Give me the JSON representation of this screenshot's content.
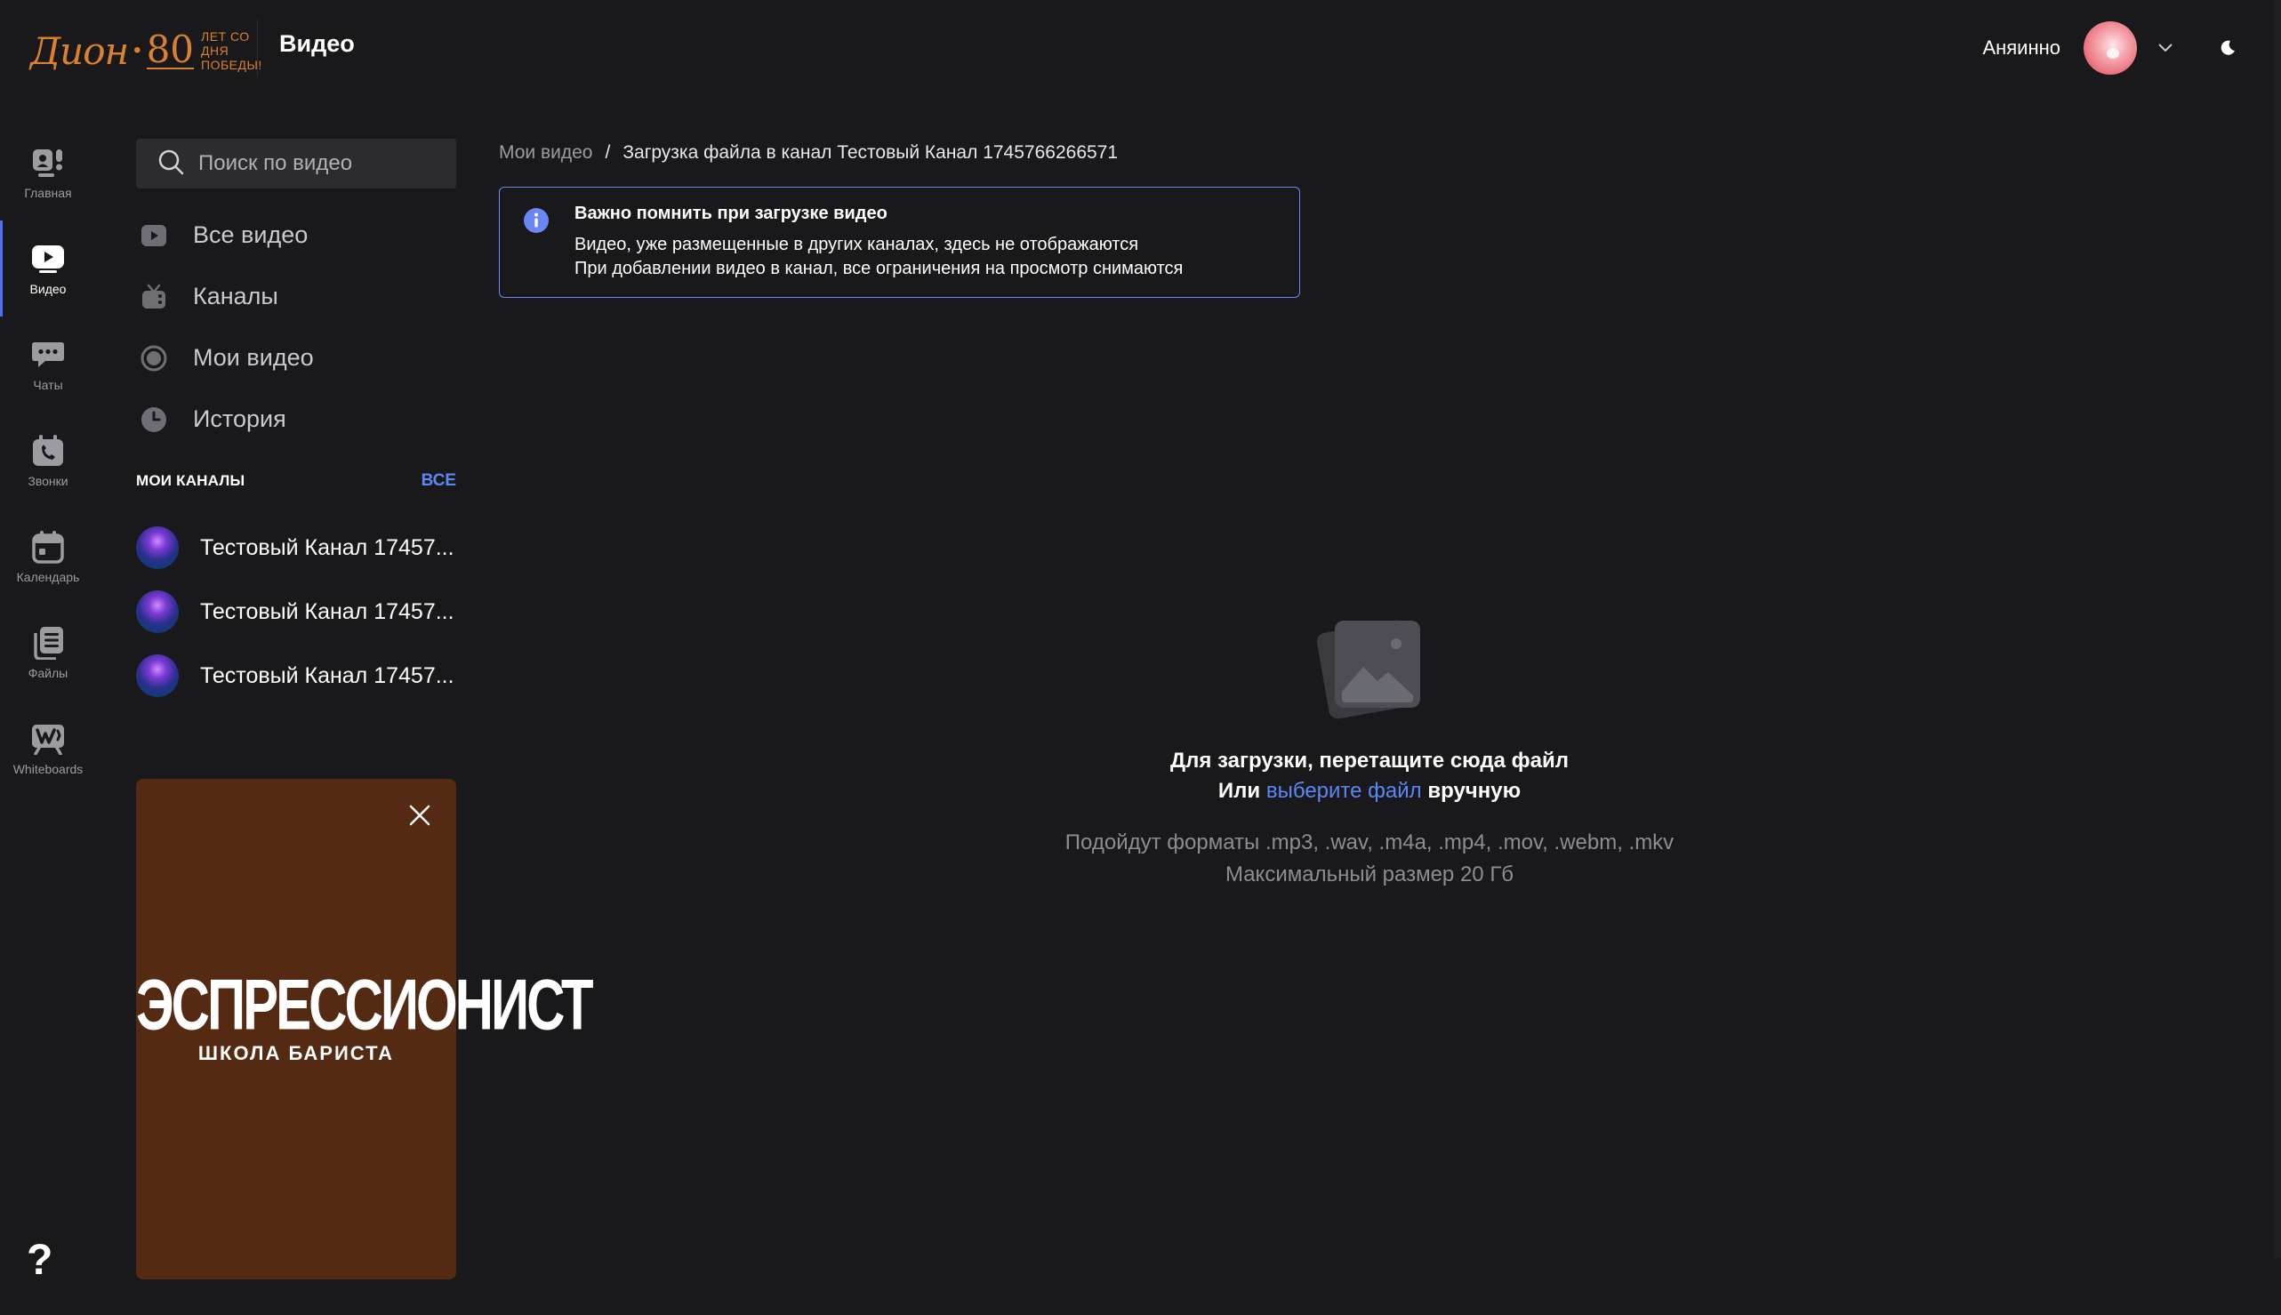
{
  "header": {
    "logo": {
      "script": "Дион",
      "number": "80",
      "tagline_1": "ЛЕТ СО ДНЯ",
      "tagline_2": "ПОБЕДЫ!"
    },
    "title": "Видео",
    "username": "Аняинно"
  },
  "rail": {
    "items": [
      {
        "label": "Главная",
        "icon": "home-icon"
      },
      {
        "label": "Видео",
        "icon": "video-icon"
      },
      {
        "label": "Чаты",
        "icon": "chat-icon"
      },
      {
        "label": "Звонки",
        "icon": "phone-icon"
      },
      {
        "label": "Календарь",
        "icon": "calendar-icon"
      },
      {
        "label": "Файлы",
        "icon": "files-icon"
      },
      {
        "label": "Whiteboards",
        "icon": "whiteboard-icon"
      }
    ],
    "help": "?"
  },
  "sidebar": {
    "search_placeholder": "Поиск по видео",
    "nav": [
      {
        "label": "Все видео",
        "icon": "play-square-icon"
      },
      {
        "label": "Каналы",
        "icon": "tv-icon"
      },
      {
        "label": "Мои видео",
        "icon": "record-icon"
      },
      {
        "label": "История",
        "icon": "clock-icon"
      }
    ],
    "channels_title": "МОИ КАНАЛЫ",
    "channels_all": "ВСЕ",
    "channels": [
      {
        "name": "Тестовый Канал 17457..."
      },
      {
        "name": "Тестовый Канал 17457..."
      },
      {
        "name": "Тестовый Канал 17457..."
      }
    ]
  },
  "promo": {
    "brand": "ЭСПРЕССИОНИСТ",
    "subtitle": "ШКОЛА БАРИСТА",
    "background": "#542a12"
  },
  "main": {
    "breadcrumb": {
      "parent": "Мои видео",
      "separator": "/",
      "current": "Загрузка файла в канал Тестовый Канал 1745766266571"
    },
    "notice": {
      "title": "Важно помнить при загрузке видео",
      "line1": "Видео, уже размещенные в других каналах, здесь не отображаются",
      "line2": "При добавлении видео в канал, все ограничения на просмотр снимаются"
    },
    "dropzone": {
      "line1": "Для загрузки, перетащите сюда файл",
      "line2_prefix": "Или",
      "line2_link": "выберите файл",
      "line2_suffix": "вручную",
      "formats": "Подойдут форматы .mp3, .wav, .m4a, .mp4, .mov, .webm, .mkv",
      "max_size": "Максимальный размер 20 Гб"
    }
  },
  "colors": {
    "background": "#19191b",
    "accent": "#4f6df5",
    "link": "#5b86f6",
    "logo": "#d9812e"
  }
}
